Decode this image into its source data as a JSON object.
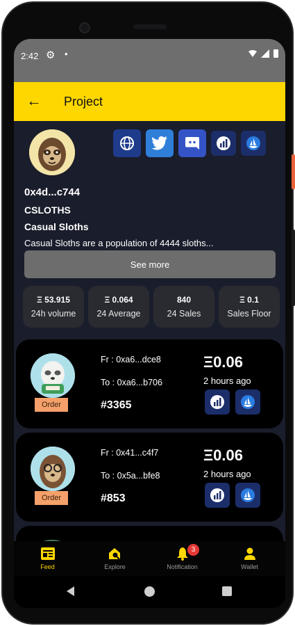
{
  "status": {
    "time": "2:42"
  },
  "appbar": {
    "title": "Project"
  },
  "collection": {
    "address": "0x4d...c744",
    "symbol": "CSLOTHS",
    "name": "Casual Sloths",
    "description": "Casual Sloths are a population of 4444 sloths...",
    "see_more_label": "See more"
  },
  "socials": [
    "globe-icon",
    "twitter-icon",
    "discord-icon",
    "chart-market-icon",
    "opensea-icon"
  ],
  "stats": [
    {
      "value": "Ξ 53.915",
      "label": "24h volume"
    },
    {
      "value": "Ξ 0.064",
      "label": "24 Average"
    },
    {
      "value": "840",
      "label": "24 Sales"
    },
    {
      "value": "Ξ 0.1",
      "label": "Sales Floor"
    }
  ],
  "sales": [
    {
      "from": "Fr : 0xa6...dce8",
      "to": "To : 0xa6...b706",
      "token": "#3365",
      "price": "Ξ0.06",
      "ago": "2 hours ago",
      "badge": "Order"
    },
    {
      "from": "Fr : 0x41...c4f7",
      "to": "To : 0x5a...bfe8",
      "token": "#853",
      "price": "Ξ0.06",
      "ago": "2 hours ago",
      "badge": "Order"
    }
  ],
  "nav": {
    "items": [
      {
        "label": "Feed",
        "icon": "feed-icon",
        "active": true
      },
      {
        "label": "Explore",
        "icon": "explore-icon",
        "active": false
      },
      {
        "label": "Notification",
        "icon": "bell-icon",
        "active": false,
        "badge": "3"
      },
      {
        "label": "Wallet",
        "icon": "person-icon",
        "active": false
      }
    ]
  },
  "colors": {
    "accent": "#ffd700",
    "background": "#1a1d2b",
    "card": "#000000",
    "badge": "#f5a06a"
  }
}
